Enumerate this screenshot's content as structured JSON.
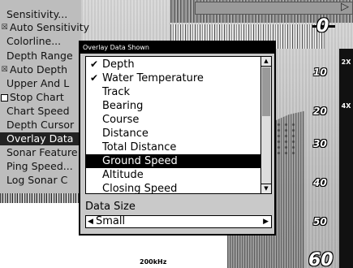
{
  "menu": {
    "items": [
      {
        "label": "Sensitivity...",
        "checkbox": null,
        "selected": false
      },
      {
        "label": "Auto Sensitivity",
        "checkbox": "checked",
        "selected": false
      },
      {
        "label": "Colorline...",
        "checkbox": null,
        "selected": false
      },
      {
        "label": "Depth Range",
        "checkbox": null,
        "selected": false
      },
      {
        "label": "Auto Depth",
        "checkbox": "checked",
        "selected": false
      },
      {
        "label": "Upper And L",
        "checkbox": null,
        "selected": false
      },
      {
        "label": "Stop Chart",
        "checkbox": "unchecked",
        "selected": false
      },
      {
        "label": "Chart Speed",
        "checkbox": null,
        "selected": false
      },
      {
        "label": "Depth Cursor",
        "checkbox": null,
        "selected": false
      },
      {
        "label": "Overlay Data",
        "checkbox": null,
        "selected": true
      },
      {
        "label": "Sonar Feature",
        "checkbox": null,
        "selected": false
      },
      {
        "label": "Ping Speed...",
        "checkbox": null,
        "selected": false
      },
      {
        "label": "Log Sonar C",
        "checkbox": null,
        "selected": false
      }
    ]
  },
  "dialog": {
    "title": "Overlay Data Shown",
    "items": [
      {
        "label": "Depth",
        "checked": true,
        "selected": false
      },
      {
        "label": "Water Temperature",
        "checked": true,
        "selected": false
      },
      {
        "label": "Track",
        "checked": false,
        "selected": false
      },
      {
        "label": "Bearing",
        "checked": false,
        "selected": false
      },
      {
        "label": "Course",
        "checked": false,
        "selected": false
      },
      {
        "label": "Distance",
        "checked": false,
        "selected": false
      },
      {
        "label": "Total Distance",
        "checked": false,
        "selected": false
      },
      {
        "label": "Ground Speed",
        "checked": false,
        "selected": true
      },
      {
        "label": "Altitude",
        "checked": false,
        "selected": false
      },
      {
        "label": "Closing Speed",
        "checked": false,
        "selected": false
      }
    ],
    "data_size_label": "Data Size",
    "data_size_value": "Small"
  },
  "sonar": {
    "frequency": "200kHz",
    "depth_labels": [
      "0",
      "10",
      "20",
      "30",
      "40",
      "50",
      "60"
    ],
    "zoom_labels": [
      "2X",
      "4X"
    ]
  }
}
